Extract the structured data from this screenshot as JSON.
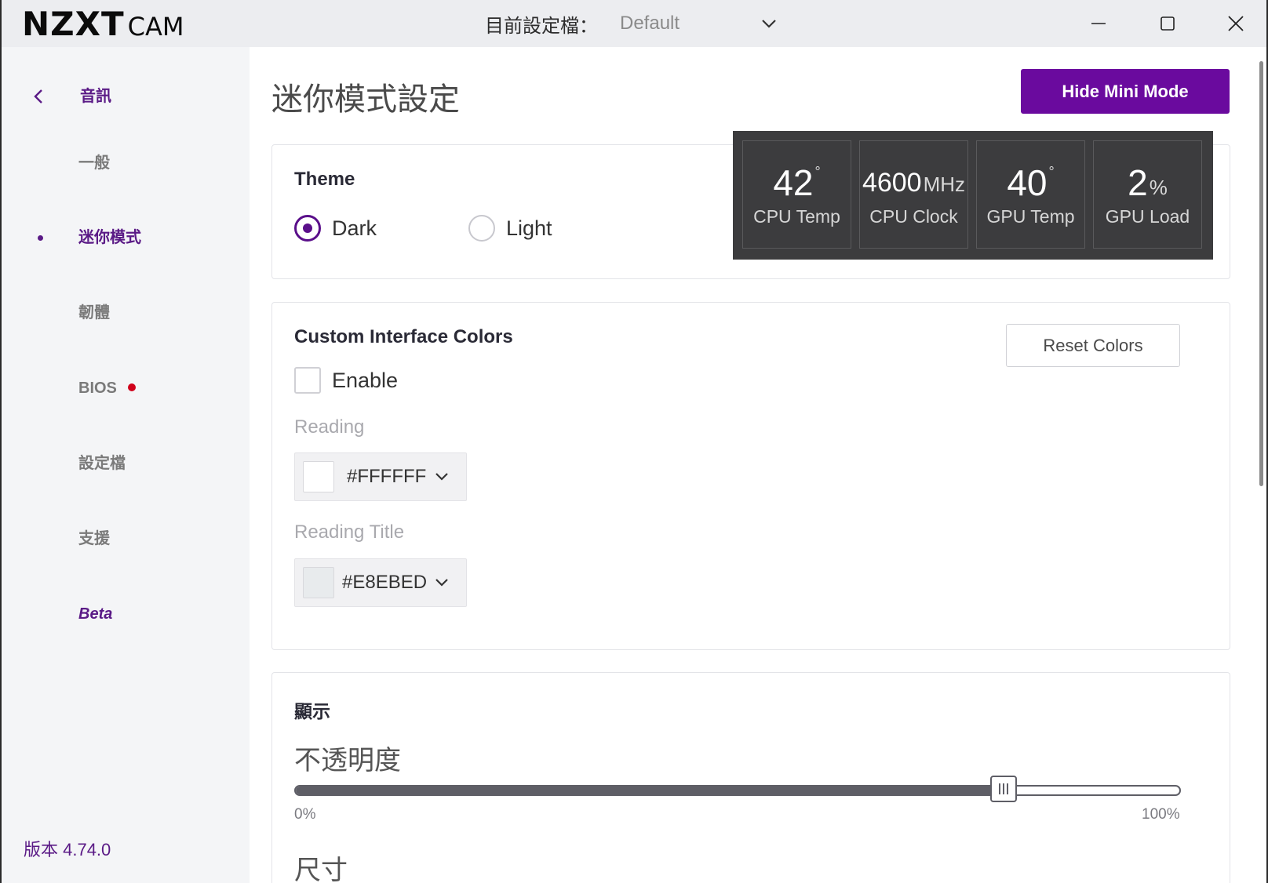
{
  "app": {
    "logo_main": "NZXT",
    "logo_sub": "CAM",
    "profile_label": "目前設定檔：",
    "profile_value": "Default",
    "window_controls": [
      "minimize-icon",
      "maximize-icon",
      "close-icon"
    ]
  },
  "sidebar": {
    "back_label": "音訊",
    "items": [
      {
        "label": "一般",
        "active": false
      },
      {
        "label": "迷你模式",
        "active": true
      },
      {
        "label": "韌體",
        "active": false
      },
      {
        "label": "BIOS",
        "active": false,
        "badge": true
      },
      {
        "label": "設定檔",
        "active": false
      },
      {
        "label": "支援",
        "active": false
      },
      {
        "label": "Beta",
        "active": false
      }
    ],
    "version": "版本 4.74.0"
  },
  "main": {
    "title": "迷你模式設定",
    "hide_button": "Hide Mini Mode",
    "theme": {
      "heading": "Theme",
      "options": [
        "Dark",
        "Light"
      ],
      "selected": "Dark"
    },
    "mini_preview": {
      "tiles": [
        {
          "value": "42",
          "unit": "°",
          "label": "CPU Temp"
        },
        {
          "value": "4600",
          "unit": "MHz",
          "label": "CPU Clock"
        },
        {
          "value": "40",
          "unit": "°",
          "label": "GPU Temp"
        },
        {
          "value": "2",
          "unit": "%",
          "label": "GPU Load"
        }
      ]
    },
    "colors": {
      "heading": "Custom Interface Colors",
      "reset_button": "Reset Colors",
      "enable_label": "Enable",
      "enable_checked": false,
      "reading_label": "Reading",
      "reading_value": "#FFFFFF",
      "reading_title_label": "Reading Title",
      "reading_title_value": "#E8EBED"
    },
    "display": {
      "heading": "顯示",
      "opacity_label": "不透明度",
      "opacity_min": "0%",
      "opacity_max": "100%",
      "opacity_value": 0.8,
      "size_label": "尺寸"
    }
  },
  "colors": {
    "accent": "#6a0a9e",
    "accent_text": "#5a1a86",
    "badge_red": "#d0021b",
    "mini_bg": "#3c3c3e"
  }
}
